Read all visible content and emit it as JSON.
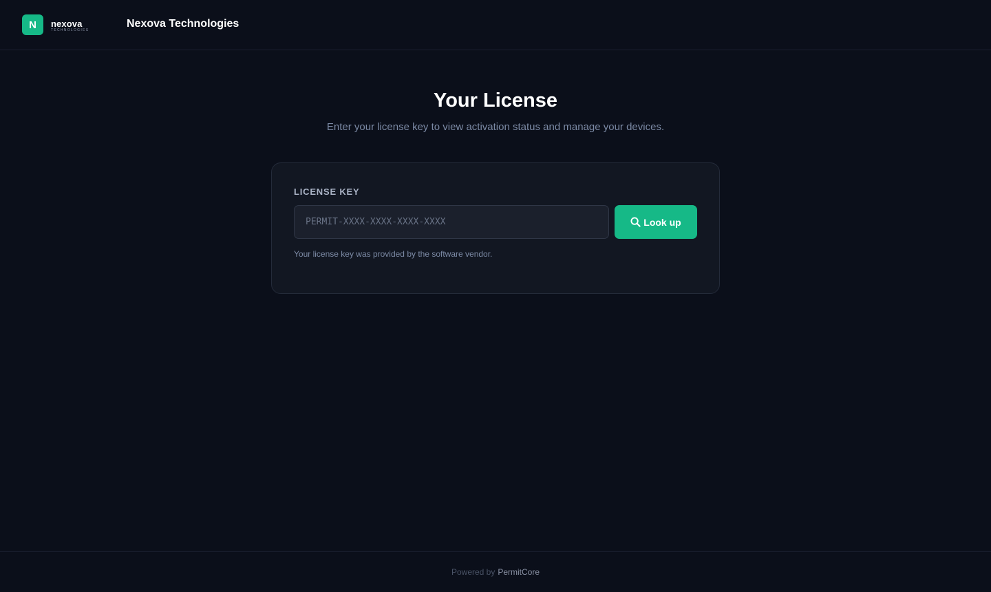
{
  "header": {
    "logo_letter": "N",
    "logo_name": "nexova",
    "logo_sub": "TECHNOLOGIES",
    "company_name": "Nexova Technologies"
  },
  "hero": {
    "title": "Your License",
    "subtitle": "Enter your license key to view activation status and manage your devices."
  },
  "form": {
    "label": "LICENSE KEY",
    "input_placeholder": "PERMIT-XXXX-XXXX-XXXX-XXXX",
    "input_value": "",
    "button_label": "Look up",
    "button_icon": "search-icon",
    "hint": "Your license key was provided by the software vendor."
  },
  "footer": {
    "prefix": "Powered by",
    "brand": "PermitCore"
  },
  "colors": {
    "background": "#0b0f1a",
    "card": "#121722",
    "accent": "#16b987"
  }
}
